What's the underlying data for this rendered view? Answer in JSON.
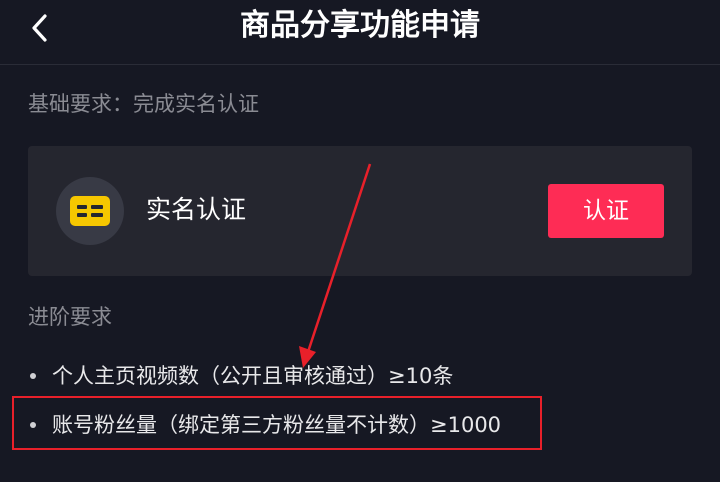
{
  "header": {
    "title": "商品分享功能申请",
    "back_icon": "chevron-left-icon"
  },
  "basic": {
    "label": "基础要求：完成实名认证",
    "card": {
      "icon": "id-card-icon",
      "title": "实名认证",
      "button_label": "认证"
    }
  },
  "advanced": {
    "label": "进阶要求",
    "items": [
      {
        "text": "个人主页视频数（公开且审核通过）≥10条"
      },
      {
        "text": "账号粉丝量（绑定第三方粉丝量不计数）≥1000"
      }
    ]
  },
  "colors": {
    "background": "#161823",
    "card": "#25262f",
    "accent": "#fe2c55",
    "icon_yellow": "#f6c700",
    "annotation_red": "#e8202a"
  }
}
